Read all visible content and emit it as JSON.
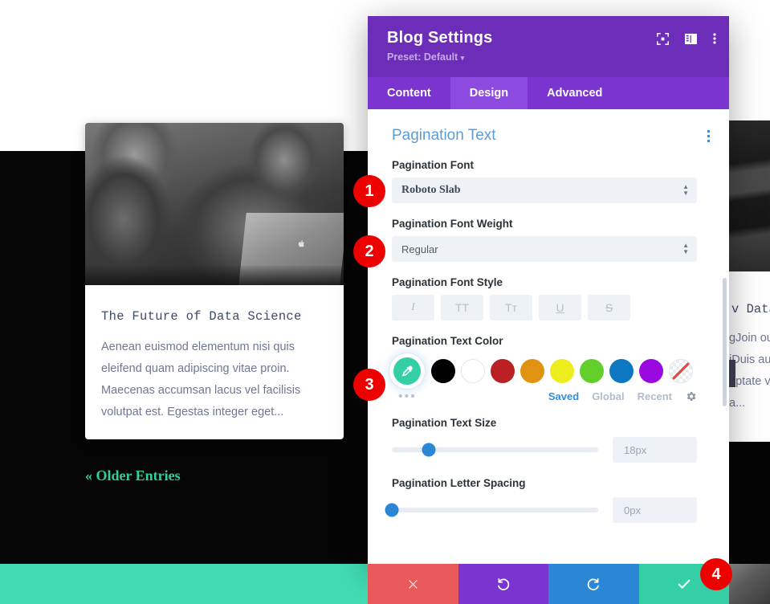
{
  "background": {
    "blog_card": {
      "title": "The Future of Data Science",
      "excerpt": "Aenean euismod elementum nisi quis eleifend quam adipiscing vitae proin. Maecenas accumsan lacus vel facilisis volutpat est. Egestas integer eget...",
      "photo_alt": "two-people-with-laptop-photo"
    },
    "pagination_link": "« Older Entries",
    "right_card": {
      "title_fragment": "v Data",
      "body_fragment": "gJoin ou\niDuis aut\nuptate ve\na..."
    }
  },
  "modal": {
    "title": "Blog Settings",
    "preset_label": "Preset: Default",
    "preset_caret": "▾",
    "header_icons": [
      "focus-target-icon",
      "layout-panel-icon",
      "kebab-menu-icon"
    ],
    "tabs": [
      {
        "label": "Content",
        "active": false
      },
      {
        "label": "Design",
        "active": true
      },
      {
        "label": "Advanced",
        "active": false
      }
    ],
    "section": {
      "title": "Pagination Text",
      "fields": {
        "font": {
          "label": "Pagination Font",
          "value": "Roboto Slab"
        },
        "font_weight": {
          "label": "Pagination Font Weight",
          "value": "Regular"
        },
        "font_style": {
          "label": "Pagination Font Style",
          "buttons": [
            {
              "glyph": "I",
              "name": "italic"
            },
            {
              "glyph": "TT",
              "name": "uppercase"
            },
            {
              "glyph": "Tт",
              "name": "capitalize"
            },
            {
              "glyph": "U",
              "name": "underline"
            },
            {
              "glyph": "S",
              "name": "strikethrough"
            }
          ]
        },
        "text_color": {
          "label": "Pagination Text Color",
          "selected": "#34cfa4",
          "selected_icon": "eyedropper-icon",
          "swatches": [
            "#000000",
            "#ffffff",
            "#bb2124",
            "#e09211",
            "#eded1d",
            "#63cf2a",
            "#0e77c2",
            "#9a0ae0"
          ],
          "none_swatch": "transparent",
          "more_label": "•••",
          "footer_links": [
            {
              "label": "Saved",
              "active": true
            },
            {
              "label": "Global",
              "active": false
            },
            {
              "label": "Recent",
              "active": false
            }
          ],
          "settings_icon": "gear-icon"
        },
        "text_size": {
          "label": "Pagination Text Size",
          "value": "18px",
          "percent": 18
        },
        "letter_spacing": {
          "label": "Pagination Letter Spacing",
          "value": "0px",
          "percent": 0
        }
      }
    }
  },
  "action_bar": [
    {
      "name": "discard-button",
      "glyph": "✖",
      "color": "#e85a5a"
    },
    {
      "name": "undo-button",
      "glyph": "↺",
      "color": "#7b34cf"
    },
    {
      "name": "redo-button",
      "glyph": "↻",
      "color": "#2b87d6"
    },
    {
      "name": "save-button",
      "glyph": "✔",
      "color": "#34cfa4"
    }
  ],
  "callouts": {
    "one": "1",
    "two": "2",
    "three": "3",
    "four": "4"
  },
  "colors": {
    "modal_header": "#6c2eb9",
    "tab_bar": "#7b34cf",
    "tab_active": "#8d4ae0",
    "section_title": "#5b9dd9",
    "accent_teal": "#41dcb4",
    "badge_red": "#ee0000"
  }
}
